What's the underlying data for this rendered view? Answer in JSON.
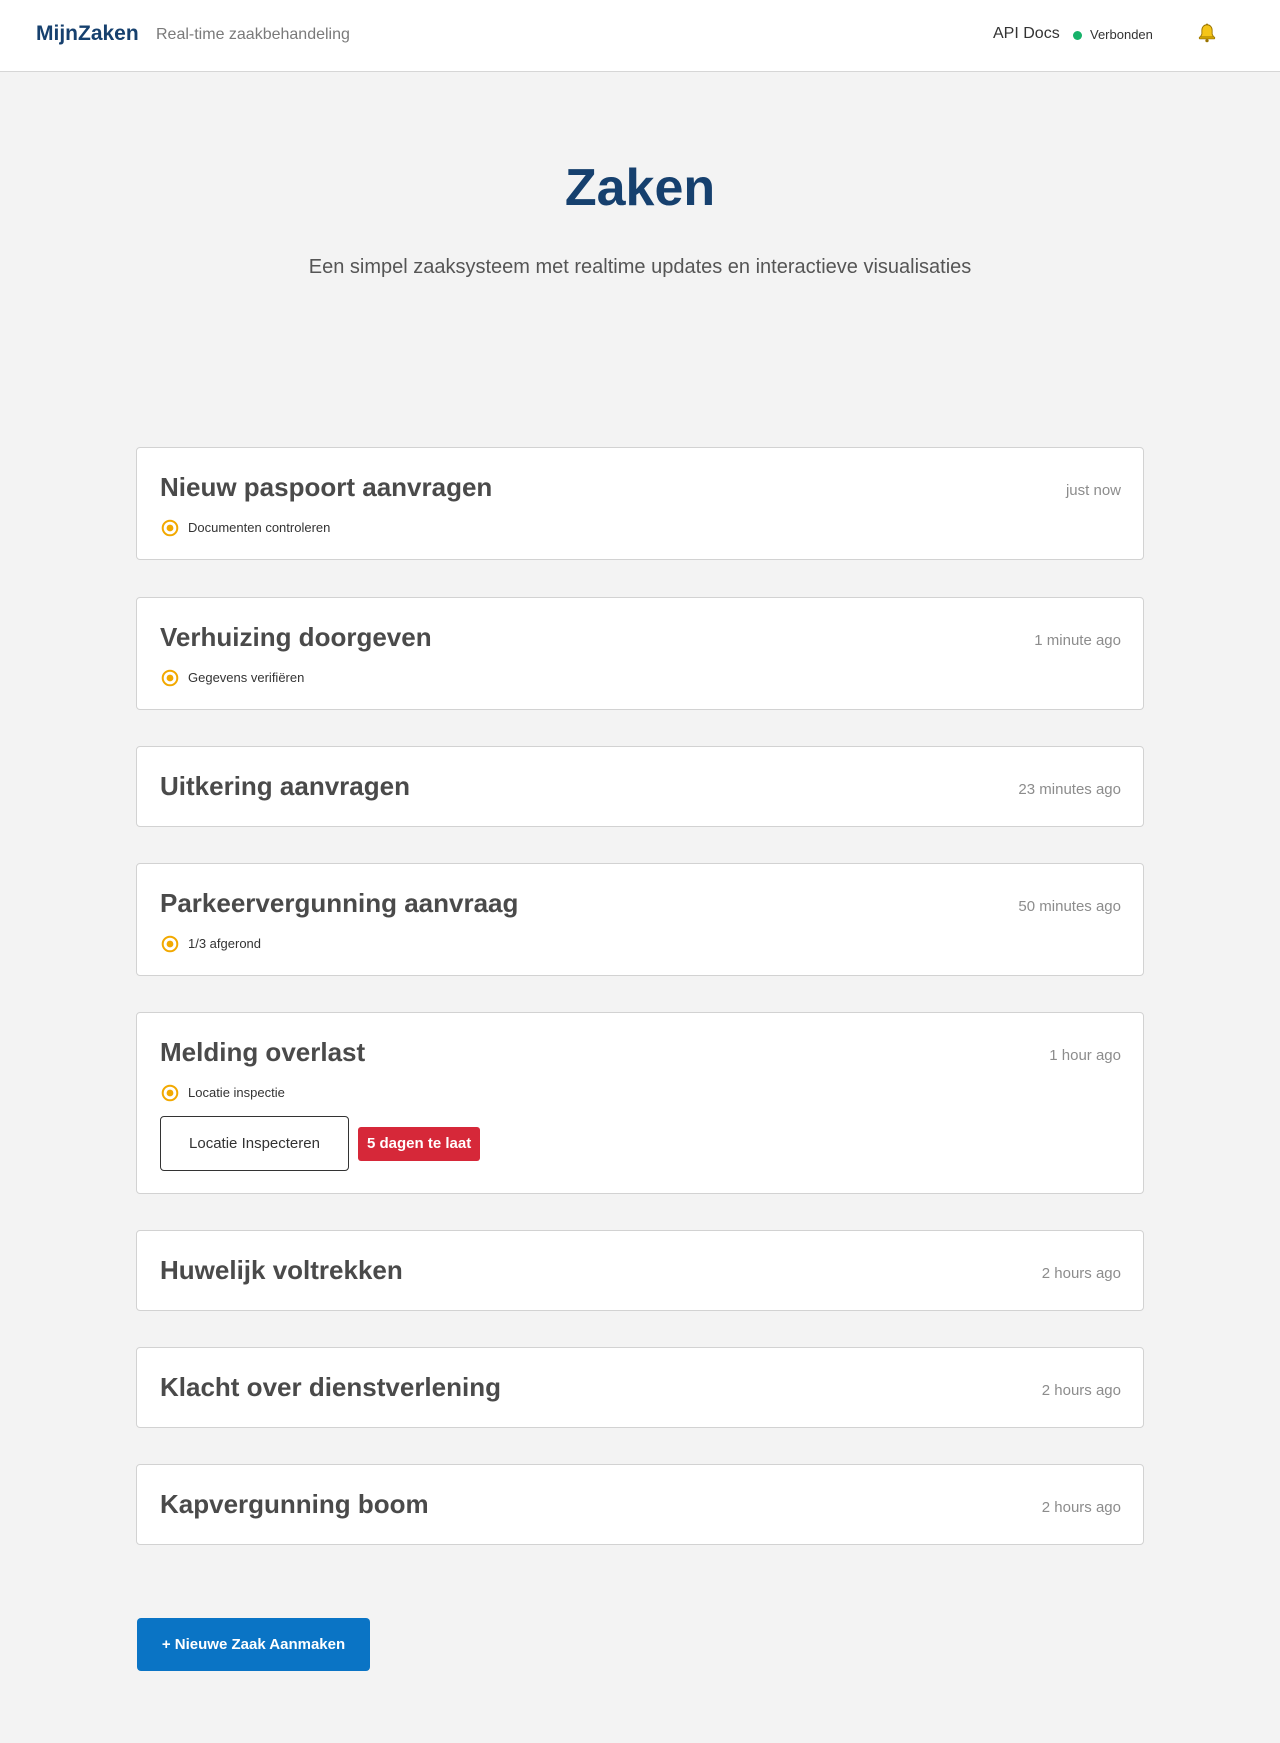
{
  "header": {
    "brand": "MijnZaken",
    "tagline": "Real-time zaakbehandeling",
    "api_docs": "API Docs",
    "connection_status": "Verbonden",
    "connection_color": "#17b26a",
    "bell_icon": "bell-icon"
  },
  "hero": {
    "title": "Zaken",
    "subtitle": "Een simpel zaaksysteem met realtime updates en interactieve visualisaties"
  },
  "cases": [
    {
      "title": "Nieuw paspoort aanvragen",
      "time": "just now",
      "status": "Documenten controleren"
    },
    {
      "title": "Verhuizing doorgeven",
      "time": "1 minute ago",
      "status": "Gegevens verifiëren"
    },
    {
      "title": "Uitkering aanvragen",
      "time": "23 minutes ago"
    },
    {
      "title": "Parkeervergunning aanvraag",
      "time": "50 minutes ago",
      "status": "1/3 afgerond"
    },
    {
      "title": "Melding overlast",
      "time": "1 hour ago",
      "status": "Locatie inspectie",
      "action_label": "Locatie Inspecteren",
      "late_badge": "5 dagen te laat"
    },
    {
      "title": "Huwelijk voltrekken",
      "time": "2 hours ago"
    },
    {
      "title": "Klacht over dienstverlening",
      "time": "2 hours ago"
    },
    {
      "title": "Kapvergunning boom",
      "time": "2 hours ago"
    }
  ],
  "create_button": "+ Nieuwe Zaak Aanmaken",
  "colors": {
    "brand": "#16406e",
    "primary_button": "#0a74c5",
    "status_icon": "#f2a900",
    "late_badge": "#d62839"
  }
}
